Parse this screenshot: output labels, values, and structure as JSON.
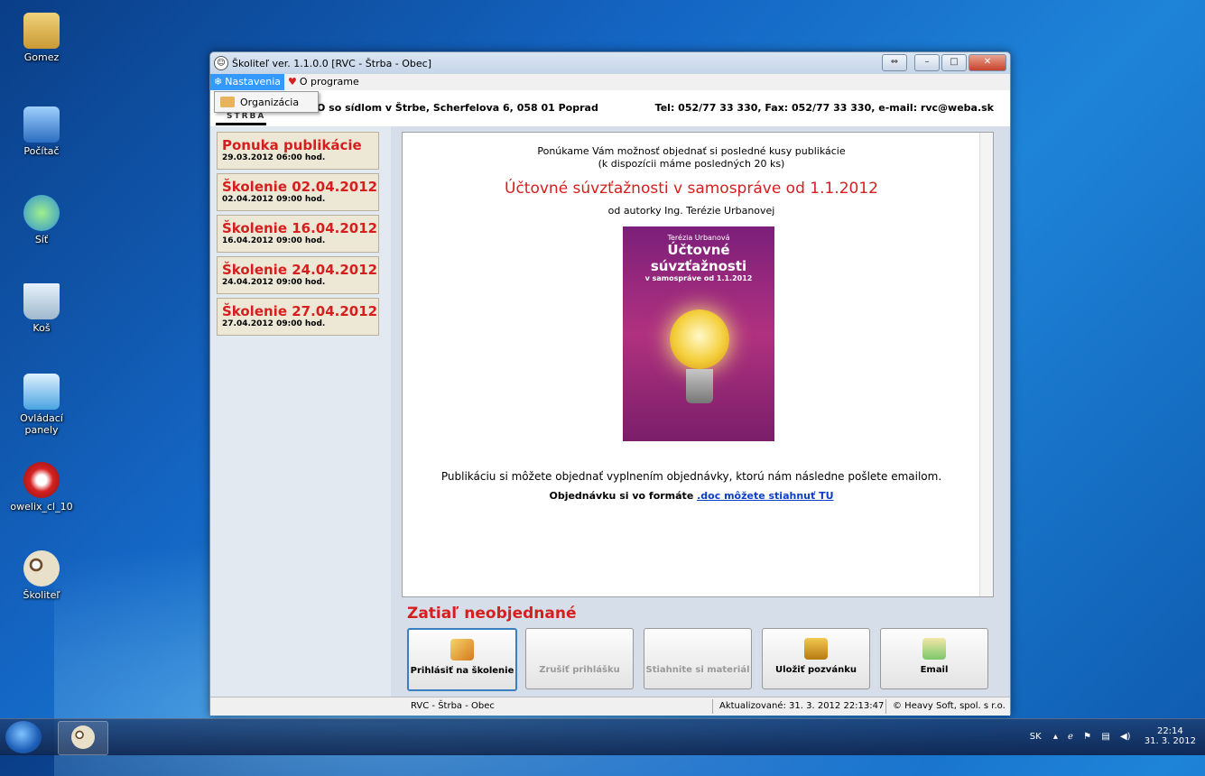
{
  "desktop": {
    "icons": [
      {
        "label": "Gomez"
      },
      {
        "label": "Počítač"
      },
      {
        "label": "Síť"
      },
      {
        "label": "Koš"
      },
      {
        "label": "Ovládací panely"
      },
      {
        "label": "owelix_cl_10"
      },
      {
        "label": "Školiteľ"
      }
    ]
  },
  "window": {
    "title": "Školiteľ ver. 1.1.0.0  [RVC - Štrba - Obec]",
    "menu": {
      "settings": "Nastavenia",
      "about": "O programe",
      "dropdown_item": "Organizácia"
    },
    "info": {
      "address": "O so sídlom v Štrbe, Scherfelova 6, 058 01 Poprad",
      "contact": "Tel: 052/77 33 330, Fax: 052/77 33 330, e-mail: rvc@weba.sk",
      "logo_text": "ŠTRBA"
    },
    "cards": [
      {
        "title": "Ponuka publikácie",
        "date": "29.03.2012 06:00 hod."
      },
      {
        "title": "Školenie 02.04.2012",
        "date": "02.04.2012 09:00 hod."
      },
      {
        "title": "Školenie 16.04.2012",
        "date": "16.04.2012 09:00 hod."
      },
      {
        "title": "Školenie 24.04.2012",
        "date": "24.04.2012 09:00 hod."
      },
      {
        "title": "Školenie 27.04.2012",
        "date": "27.04.2012 09:00 hod."
      }
    ],
    "content": {
      "line1": "Ponúkame Vám  možnosť objednať si posledné kusy publikácie",
      "line2": "(k dispozícii máme posledných 20 ks)",
      "headline": "Účtovné súvzťažnosti v samospráve od 1.1.2012",
      "author": "od autorky Ing. Terézie Urbanovej",
      "book_author": "Terézia Urbanová",
      "book_title": "Účtovné súvzťažnosti",
      "book_subtitle": "v samospráve od 1.1.2012",
      "order_text": "Publikáciu si môžete objednať vyplnením objednávky, ktorú nám následne pošlete emailom.",
      "download_prefix": "Objednávku si vo formáte ",
      "download_link": ".doc môžete stiahnuť TU"
    },
    "status_title": "Zatiaľ neobjednané",
    "buttons": {
      "register": "Prihlásiť na školenie",
      "cancel": "Zrušiť prihlášku",
      "download": "Stiahnite si materiál",
      "save": "Uložiť pozvánku",
      "email": "Email"
    },
    "statusbar": {
      "org": "RVC - Štrba - Obec",
      "updated": "Aktualizované: 31. 3. 2012 22:13:47",
      "copyright": "© Heavy Soft, spol. s r.o."
    }
  },
  "taskbar": {
    "lang": "SK",
    "time": "22:14",
    "date": "31. 3. 2012"
  }
}
